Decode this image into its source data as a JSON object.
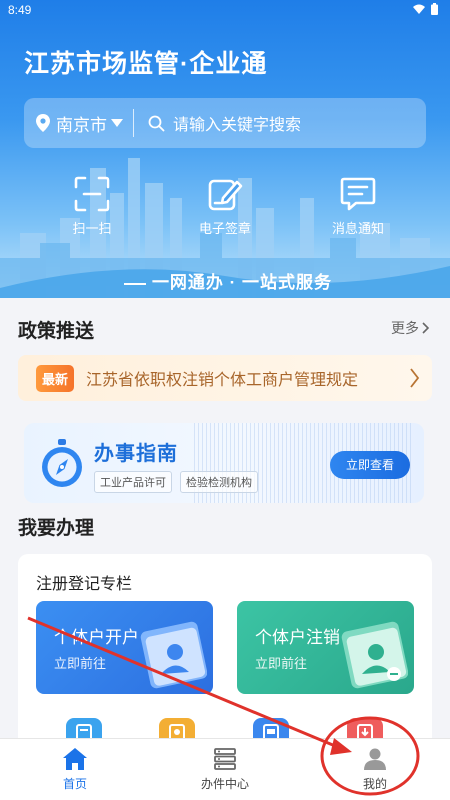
{
  "status_bar": {
    "time": "8:49"
  },
  "header": {
    "title": "江苏市场监管·企业通"
  },
  "search": {
    "city": "南京市",
    "placeholder": "请输入关键字搜索"
  },
  "quick_actions": [
    {
      "label": "扫一扫",
      "icon": "scan-icon"
    },
    {
      "label": "电子签章",
      "icon": "e-signature-icon"
    },
    {
      "label": "消息通知",
      "icon": "message-icon"
    }
  ],
  "banner": {
    "slogan": "一网通办 · 一站式服务"
  },
  "policy": {
    "title": "政策推送",
    "more_label": "更多",
    "badge": "最新",
    "headline": "江苏省依职权注销个体工商户管理规定"
  },
  "guide": {
    "title": "办事指南",
    "tags": [
      "工业产品许可",
      "检验检测机构"
    ],
    "button_label": "立即查看"
  },
  "todo": {
    "title": "我要办理",
    "card_title": "注册登记专栏",
    "tiles": [
      {
        "name": "个体户开户",
        "sub": "立即前往"
      },
      {
        "name": "个体户注销",
        "sub": "立即前往"
      }
    ]
  },
  "tabbar": {
    "items": [
      {
        "label": "首页",
        "icon": "home-icon",
        "active": true
      },
      {
        "label": "办件中心",
        "icon": "server-icon",
        "active": false
      },
      {
        "label": "我的",
        "icon": "user-icon",
        "active": false
      }
    ]
  },
  "colors": {
    "accent": "#1b73e8",
    "annotation": "#e0322b",
    "policy_text": "#a8652a"
  }
}
